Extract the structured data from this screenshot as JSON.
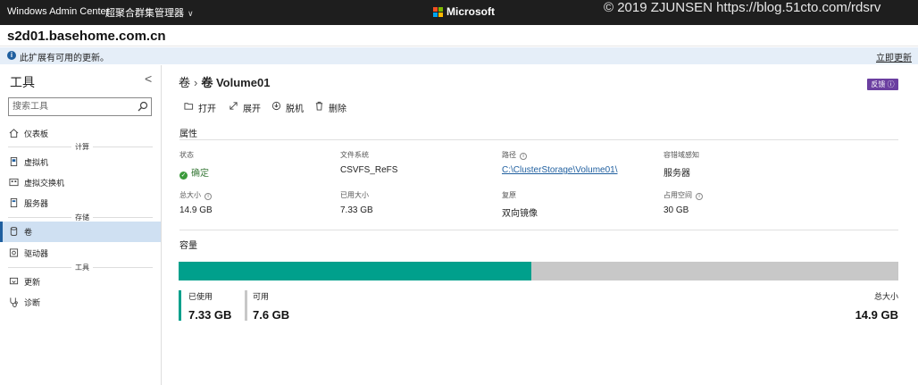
{
  "topbar": {
    "app_name": "Windows Admin Center",
    "connection_manager": "超聚合群集管理器",
    "brand": "Microsoft",
    "watermark": "© 2019 ZJUNSEN https://blog.51cto.com/rdsrv"
  },
  "server": {
    "name": "s2d01.basehome.com.cn"
  },
  "notice": {
    "text": "此扩展有可用的更新。",
    "action": "立即更新"
  },
  "sidebar": {
    "title": "工具",
    "search_placeholder": "搜索工具",
    "items": [
      {
        "label": "仪表板",
        "icon": "home-icon"
      },
      {
        "label": "虚拟机",
        "icon": "vm-icon"
      },
      {
        "label": "虚拟交换机",
        "icon": "switch-icon"
      },
      {
        "label": "服务器",
        "icon": "server-icon"
      },
      {
        "label": "卷",
        "icon": "cylinder-icon",
        "active": true
      },
      {
        "label": "驱动器",
        "icon": "drive-icon"
      },
      {
        "label": "更新",
        "icon": "update-icon"
      },
      {
        "label": "诊断",
        "icon": "stethoscope-icon"
      }
    ],
    "sections": [
      "计算",
      "存储",
      "工具"
    ]
  },
  "main": {
    "breadcrumb": {
      "parent": "卷",
      "current": "卷 Volume01"
    },
    "feedback": "反馈",
    "actions": [
      "打开",
      "展开",
      "脱机",
      "删除"
    ],
    "properties_title": "属性",
    "properties": {
      "status_label": "状态",
      "status_value": "确定",
      "fs_label": "文件系统",
      "fs_value": "CSVFS_ReFS",
      "path_label": "路径",
      "path_value": "C:\\ClusterStorage\\Volume01\\",
      "fault_label": "容错域感知",
      "fault_value": "服务器",
      "total_label": "总大小",
      "total_value": "14.9 GB",
      "used_label": "已用大小",
      "used_value": "7.33 GB",
      "resiliency_label": "复原",
      "resiliency_value": "双向镜像",
      "footprint_label": "占用空间",
      "footprint_value": "30 GB"
    },
    "capacity": {
      "title": "容量",
      "used_label": "已使用",
      "used_value": "7.33 GB",
      "free_label": "可用",
      "free_value": "7.6 GB",
      "total_label": "总大小",
      "total_value": "14.9 GB",
      "used_fraction": 0.49,
      "used_color": "#00a08c",
      "free_color": "#c8c8c8"
    }
  },
  "colors": {
    "accent": "#1f5f9f",
    "feedback": "#6b3fa0",
    "ok": "#3a9a3a"
  }
}
